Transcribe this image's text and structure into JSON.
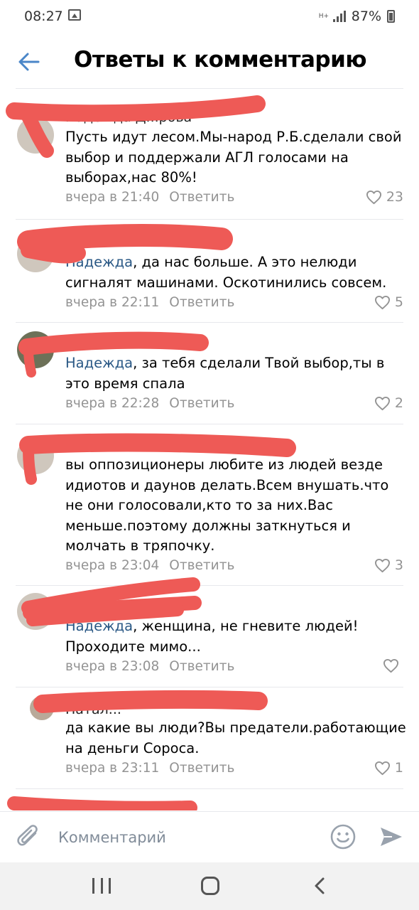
{
  "status_bar": {
    "time": "08:27",
    "battery": "87%",
    "network": "H+"
  },
  "header": {
    "title": "Ответы к комментарию"
  },
  "comments": [
    {
      "author": "Надежда Д...рова",
      "mention": "",
      "text": "Пусть идут лесом.Мы-народ Р.Б.сделали свой выбор и поддержали АГЛ голосами на выборах,нас 80%!",
      "time": "вчера в 21:40",
      "reply": "Ответить",
      "likes": "23"
    },
    {
      "author": "",
      "mention": "Надежда",
      "text": ", да нас больше. А это нелюди сигналят машинами.  Оскотинились совсем.",
      "time": "вчера в 22:11",
      "reply": "Ответить",
      "likes": "5"
    },
    {
      "author": "",
      "mention": "Надежда",
      "text": ", за тебя сделали  Твой выбор,ты в это время спала",
      "time": "вчера в 22:28",
      "reply": "Ответить",
      "likes": "2"
    },
    {
      "author": "",
      "mention": "",
      "text": "вы оппозиционеры любите из людей везде идиотов и даунов делать.Всем внушать.что не они голосовали,кто то за них.Вас меньше.поэтому должны заткнуться и молчать в тряпочку.",
      "time": "вчера в 23:04",
      "reply": "Ответить",
      "likes": "3"
    },
    {
      "author": "",
      "mention": "Надежда",
      "text": ", женщина, не гневите людей! Проходите мимо...",
      "time": "вчера в 23:08",
      "reply": "Ответить",
      "likes": ""
    },
    {
      "author": "Натал...",
      "mention": "",
      "text": "да какие вы люди?Вы предатели.работающие на деньги Сороса.",
      "time": "вчера в 23:11",
      "reply": "Ответить",
      "likes": "1"
    }
  ],
  "input": {
    "placeholder": "Комментарий"
  },
  "icons": {
    "back": "back-arrow-icon",
    "attach": "paperclip-icon",
    "emoji": "emoji-icon",
    "send": "send-icon",
    "like": "heart-icon"
  },
  "colors": {
    "accent": "#2a5885",
    "back_arrow": "#4a86c8",
    "redaction": "#ee5a56",
    "meta_text": "#939393"
  }
}
